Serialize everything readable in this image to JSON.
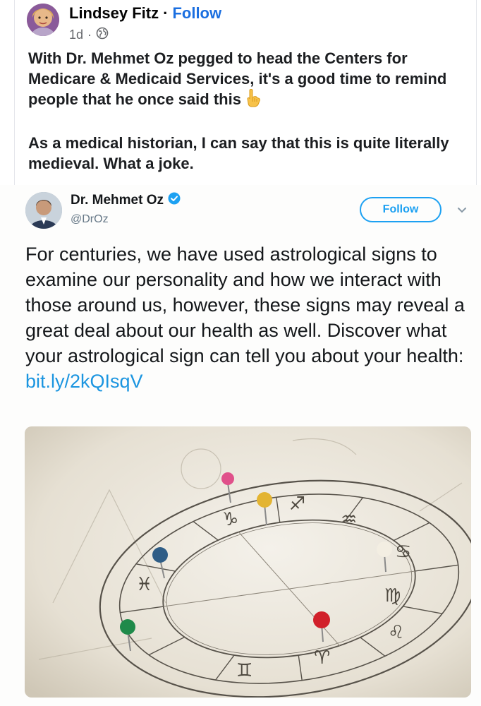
{
  "facebook_post": {
    "author_name": "Lindsey Fitz",
    "separator": "·",
    "follow_label": "Follow",
    "timestamp": "1d",
    "meta_separator": "·",
    "privacy_icon": "globe-icon",
    "paragraph_1": "With Dr. Mehmet Oz pegged to head the Centers for Medicare & Medicaid Services, it's a good time to remind people that he once said this",
    "pointing_emoji": "backhand-index-pointing-down",
    "paragraph_2": "As a medical historian, I can say that this is quite literally medieval. What a joke."
  },
  "tweet": {
    "display_name": "Dr. Mehmet Oz",
    "verified_icon": "verified-badge-icon",
    "handle": "@DrOz",
    "follow_label": "Follow",
    "text": "For centuries, we have used astrological signs to examine our personality and how we interact with those around us, however, these signs may reveal a great deal about our health as well. Discover what your astrological sign can tell you about your health:",
    "link_text": "bit.ly/2kQIsqV",
    "image_subject": "zodiac wheel chart with colored map pins",
    "zodiac_glyphs": {
      "leo": "♌",
      "virgo": "♍",
      "cancer": "♋",
      "gemini": "♊",
      "pisces": "♓",
      "aquarius": "♒",
      "capricorn": "♑",
      "sagittarius": "♐",
      "aries": "♈"
    }
  },
  "colors": {
    "facebook_link": "#1b6fe0",
    "twitter_blue": "#1da1f2",
    "twitter_link": "#1b95e0"
  }
}
